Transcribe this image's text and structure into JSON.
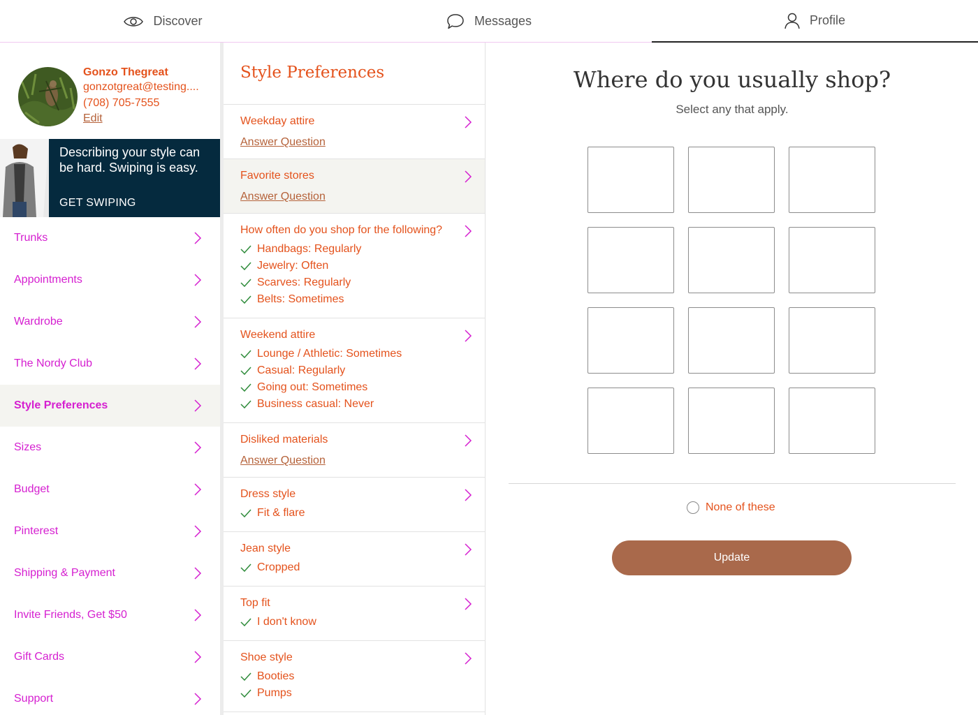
{
  "topnav": {
    "tabs": [
      {
        "label": "Discover",
        "icon": "eye-icon"
      },
      {
        "label": "Messages",
        "icon": "speech-bubble-icon"
      },
      {
        "label": "Profile",
        "icon": "person-icon"
      }
    ],
    "active_tab": "Profile"
  },
  "user": {
    "name": "Gonzo Thegreat",
    "email": "gonzotgreat@testing....",
    "phone": "(708) 705-7555",
    "edit_label": "Edit"
  },
  "promo": {
    "text": "Describing your style can be hard. Swiping is easy.",
    "cta": "GET SWIPING"
  },
  "sidebar": {
    "items": [
      {
        "label": "Trunks"
      },
      {
        "label": "Appointments"
      },
      {
        "label": "Wardrobe"
      },
      {
        "label": "The Nordy Club"
      },
      {
        "label": "Style Preferences",
        "active": true
      },
      {
        "label": "Sizes"
      },
      {
        "label": "Budget"
      },
      {
        "label": "Pinterest"
      },
      {
        "label": "Shipping & Payment"
      },
      {
        "label": "Invite Friends, Get $50"
      },
      {
        "label": "Gift Cards"
      },
      {
        "label": "Support"
      }
    ]
  },
  "style_preferences": {
    "title": "Style Preferences",
    "questions": [
      {
        "title": "Weekday attire",
        "link": "Answer Question"
      },
      {
        "title": "Favorite stores",
        "link": "Answer Question",
        "active": true
      },
      {
        "title": "How often do you shop for the following?",
        "answers": [
          "Handbags: Regularly",
          "Jewelry: Often",
          "Scarves: Regularly",
          "Belts: Sometimes"
        ]
      },
      {
        "title": "Weekend attire",
        "answers": [
          "Lounge / Athletic: Sometimes",
          "Casual: Regularly",
          "Going out: Sometimes",
          "Business casual: Never"
        ]
      },
      {
        "title": "Disliked materials",
        "link": "Answer Question"
      },
      {
        "title": "Dress style",
        "answers": [
          "Fit & flare"
        ]
      },
      {
        "title": "Jean style",
        "answers": [
          "Cropped"
        ]
      },
      {
        "title": "Top fit",
        "answers": [
          "I don't know"
        ]
      },
      {
        "title": "Shoe style",
        "answers": [
          "Booties",
          "Pumps"
        ]
      }
    ]
  },
  "main": {
    "title": "Where do you usually shop?",
    "subtitle": "Select any that apply.",
    "tile_count": 12,
    "none_label": "None of these",
    "update_label": "Update"
  },
  "colors": {
    "accent_orange": "#e4521c",
    "nav_magenta": "#d51fd0",
    "button_brown": "#a9694b",
    "promo_navy": "#052a3e",
    "check_green": "#2e8b3a"
  }
}
